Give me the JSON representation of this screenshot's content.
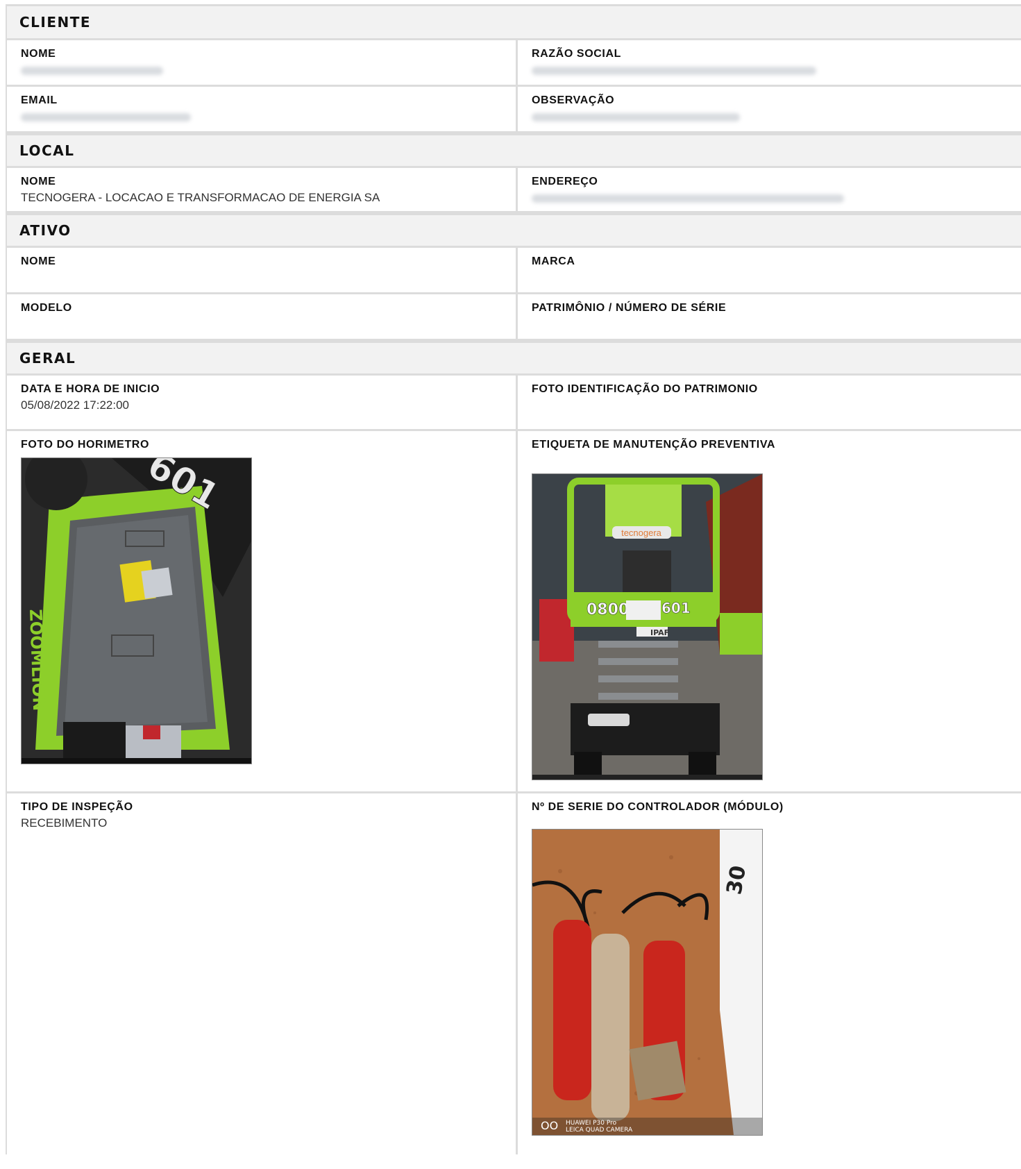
{
  "sections": {
    "cliente": "CLIENTE",
    "local": "LOCAL",
    "ativo": "ATIVO",
    "geral": "GERAL"
  },
  "cliente": {
    "nome_label": "NOME",
    "razao_label": "RAZÃO SOCIAL",
    "email_label": "EMAIL",
    "obs_label": "OBSERVAÇÃO"
  },
  "local": {
    "nome_label": "NOME",
    "nome_value": "TECNOGERA - LOCACAO E TRANSFORMACAO DE ENERGIA SA",
    "endereco_label": "ENDEREÇO"
  },
  "ativo": {
    "nome_label": "NOME",
    "marca_label": "MARCA",
    "modelo_label": "MODELO",
    "patrimonio_label": "PATRIMÔNIO / NÚMERO DE SÉRIE"
  },
  "geral": {
    "data_label": "DATA E HORA DE INICIO",
    "data_value": "05/08/2022 17:22:00",
    "foto_patrimonio_label": "FOTO IDENTIFICAÇÃO DO PATRIMONIO",
    "foto_horimetro_label": "FOTO DO HORIMETRO",
    "etiqueta_label": "ETIQUETA DE MANUTENÇÃO PREVENTIVA",
    "tipo_label": "TIPO DE INSPEÇÃO",
    "tipo_value": "RECEBIMENTO",
    "serie_label": "Nº DE SERIE DO CONTROLADOR (MÓDULO)"
  },
  "photos": {
    "horimetro": {
      "brand": "ZOOMLION",
      "number": "601"
    },
    "etiqueta": {
      "logo": "tecnogera",
      "phone_left": "0800",
      "phone_right": "601",
      "cert": "IPAF"
    },
    "serie": {
      "camera_line1": "HUAWEI P30 Pro",
      "camera_line2": "LEICA QUAD CAMERA"
    }
  },
  "colors": {
    "section_bg": "#f2f2f2",
    "border": "#dcdcdc",
    "machine_green": "#8dcf2a"
  }
}
